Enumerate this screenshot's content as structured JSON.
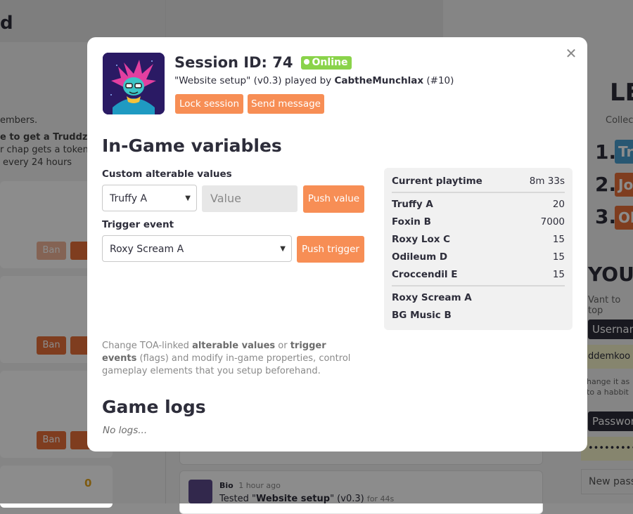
{
  "background": {
    "title_fragment": "d",
    "members_text": "embers.",
    "truddz_line1": "e to get a Truddz to",
    "truddz_line2": "r chap gets a token",
    "truddz_line3": "every 24 hours",
    "ban_label": "Ban",
    "coin_value": "0",
    "feed_author": "Bio",
    "feed_time": "1 hour ago",
    "feed_text_prefix": "Tested \"",
    "feed_text_game": "Website setup",
    "feed_text_suffix": "\" (v0.3)",
    "feed_text_duration": "for 44s",
    "leaderboard_title": "LE",
    "leaderboard_sub": "Collec",
    "rank1": "1.",
    "rank2": "2.",
    "rank3": "3.",
    "tag1": "Tr",
    "tag2": "Jo",
    "tag3": "Ol",
    "your_title": "YOUR",
    "want_to_text": "Vant to top",
    "username_label": "Usernam",
    "username_value": "ddemkoo",
    "change_note1": "hange it as",
    "change_note2": "to a habbit",
    "password_label": "Password",
    "password_value": "•••••••••••",
    "new_pass_placeholder": "New passw"
  },
  "modal": {
    "session_title": "Session ID: 74",
    "status_badge": "Online",
    "played_prefix": "\"Website setup\" (v0.3) played by ",
    "player_name": "CabtheMunchlax",
    "player_suffix": " (#10)",
    "lock_button": "Lock session",
    "send_button": "Send message",
    "variables_heading": "In-Game variables",
    "custom_label": "Custom alterable values",
    "custom_select_value": "Truffy A",
    "value_placeholder": "Value",
    "push_value_button": "Push value",
    "trigger_label": "Trigger event",
    "trigger_select_value": "Roxy Scream A",
    "push_trigger_button": "Push trigger",
    "playtime_label": "Current playtime",
    "playtime_value": "8m 33s",
    "values": [
      {
        "name": "Truffy A",
        "value": "20"
      },
      {
        "name": "Foxin B",
        "value": "7000"
      },
      {
        "name": "Roxy Lox C",
        "value": "15"
      },
      {
        "name": "Odileum D",
        "value": "15"
      },
      {
        "name": "Croccendil E",
        "value": "15"
      }
    ],
    "events": [
      "Roxy Scream A",
      "BG Music B"
    ],
    "desc_1": "Change TOA-linked ",
    "desc_b1": "alterable values",
    "desc_2": " or ",
    "desc_b2": "trigger events",
    "desc_3": " (flags) and modify in-game properties, control gameplay elements that you setup beforehand.",
    "logs_heading": "Game logs",
    "no_logs": "No logs..."
  },
  "colors": {
    "accent_orange": "#f78e55",
    "online_green": "#8ad34a",
    "text_dark": "#2d2d3a"
  }
}
